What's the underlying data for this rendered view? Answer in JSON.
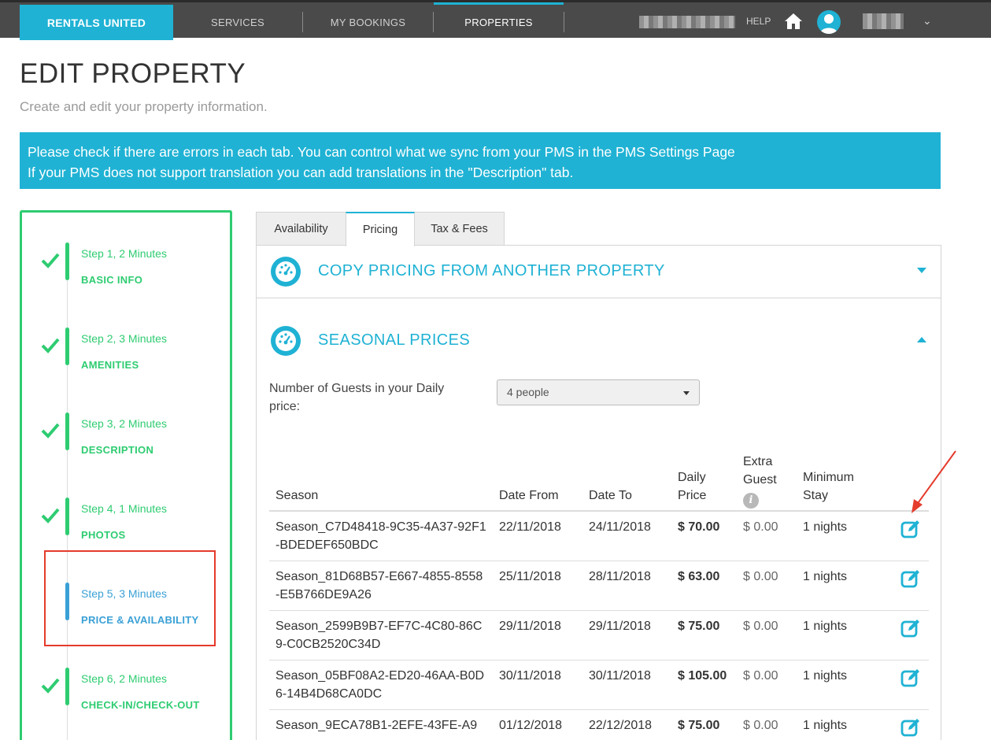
{
  "nav": {
    "brand": "RENTALS UNITED",
    "items": [
      {
        "label": "SERVICES"
      },
      {
        "label": "MY BOOKINGS"
      },
      {
        "label": "PROPERTIES"
      }
    ],
    "help": "HELP"
  },
  "header": {
    "title": "EDIT PROPERTY",
    "subtitle": "Create and edit your property information."
  },
  "notice": {
    "line1": "Please check if there are errors in each tab. You can control what we sync from your PMS in the PMS Settings Page",
    "line2": "If your PMS does not support translation you can add translations in the \"Description\" tab."
  },
  "steps": [
    {
      "time": "Step 1, 2 Minutes",
      "name": "BASIC INFO",
      "done": true
    },
    {
      "time": "Step 2, 3 Minutes",
      "name": "AMENITIES",
      "done": true
    },
    {
      "time": "Step 3, 2 Minutes",
      "name": "DESCRIPTION",
      "done": true
    },
    {
      "time": "Step 4, 1 Minutes",
      "name": "PHOTOS",
      "done": true
    },
    {
      "time": "Step 5, 3 Minutes",
      "name": "PRICE & AVAILABILITY",
      "done": false
    },
    {
      "time": "Step 6, 2 Minutes",
      "name": "CHECK-IN/CHECK-OUT",
      "done": true
    }
  ],
  "tabs": [
    {
      "label": "Availability"
    },
    {
      "label": "Pricing"
    },
    {
      "label": "Tax & Fees"
    }
  ],
  "sections": {
    "copy": "COPY PRICING FROM ANOTHER PROPERTY",
    "seasonal": "SEASONAL PRICES"
  },
  "guests": {
    "label": "Number of Guests in your Daily price:",
    "value": "4 people"
  },
  "table": {
    "headers": {
      "season": "Season",
      "from": "Date From",
      "to": "Date To",
      "daily1": "Daily",
      "daily2": "Price",
      "extra1": "Extra",
      "extra2": "Guest",
      "min1": "Minimum",
      "min2": "Stay"
    },
    "rows": [
      {
        "season": "Season_C7D48418-9C35-4A37-92F1-BDEDEF650BDC",
        "from": "22/11/2018",
        "to": "24/11/2018",
        "price": "$ 70.00",
        "extra": "$ 0.00",
        "min": "1 nights"
      },
      {
        "season": "Season_81D68B57-E667-4855-8558-E5B766DE9A26",
        "from": "25/11/2018",
        "to": "28/11/2018",
        "price": "$ 63.00",
        "extra": "$ 0.00",
        "min": "1 nights"
      },
      {
        "season": "Season_2599B9B7-EF7C-4C80-86C9-C0CB2520C34D",
        "from": "29/11/2018",
        "to": "29/11/2018",
        "price": "$ 75.00",
        "extra": "$ 0.00",
        "min": "1 nights"
      },
      {
        "season": "Season_05BF08A2-ED20-46AA-B0D6-14B4D68CA0DC",
        "from": "30/11/2018",
        "to": "30/11/2018",
        "price": "$ 105.00",
        "extra": "$ 0.00",
        "min": "1 nights"
      },
      {
        "season": "Season_9ECA78B1-2EFE-43FE-A9",
        "from": "01/12/2018",
        "to": "22/12/2018",
        "price": "$ 75.00",
        "extra": "$ 0.00",
        "min": "1 nights"
      }
    ]
  },
  "colors": {
    "accent": "#1fb2d4",
    "success": "#2ecc71",
    "current": "#3aa0d6",
    "annotation": "#e53b2c"
  }
}
